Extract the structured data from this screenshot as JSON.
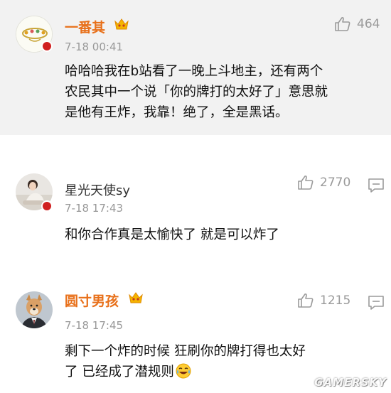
{
  "comments": [
    {
      "username": "一番其",
      "time": "7-18 00:41",
      "likes": "464",
      "lines": [
        "哈哈哈我在b站看了一晚上斗地主，还有两个",
        "农民其中一个说「你的牌打的太好了」意思就",
        "是他有王炸，我靠！绝了，全是黑话。"
      ]
    },
    {
      "username": "星光天使sy",
      "time": "7-18 17:43",
      "likes": "2770",
      "lines": [
        "和你合作真是太愉快了   就是可以炸了"
      ]
    },
    {
      "username": "圆寸男孩",
      "time": "7-18 17:45",
      "likes": "1215",
      "lines": [
        "剩下一个炸的时候 狂刷你的牌打得也太好",
        "了 已经成了潜规则"
      ]
    }
  ],
  "watermark": "GAMERSKY",
  "colors": {
    "vip_name": "#e8701a",
    "highlight_bg": "#f2f2f2",
    "meta": "#999999"
  }
}
